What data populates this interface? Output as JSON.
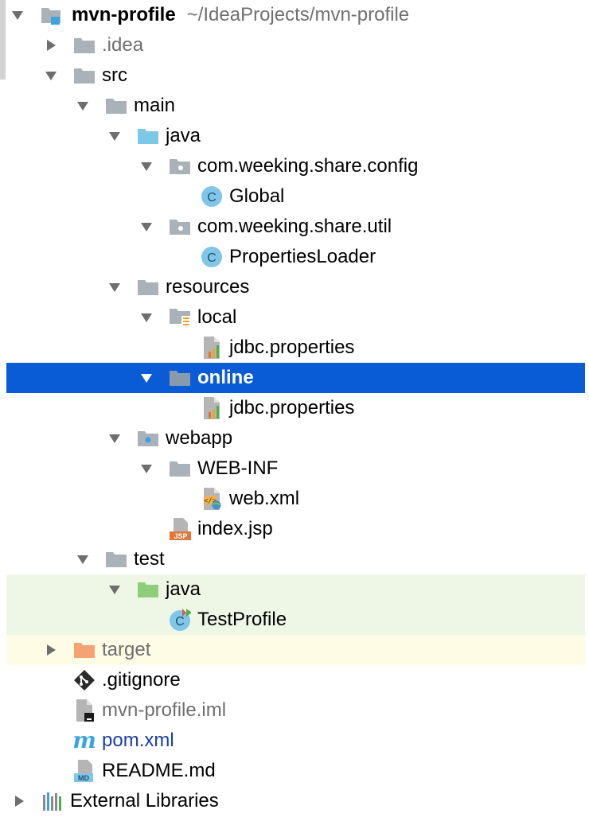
{
  "colors": {
    "selection": "#0a5cd6",
    "folder_gray": "#a9b2b8",
    "source_blue": "#7cc8e6",
    "test_green": "#8fce79",
    "excluded_orange": "#f4a470",
    "class_circle": "#7fc6e8",
    "test_row_bg": "#eef7e6",
    "excluded_row_bg": "#fefce4"
  },
  "tree": {
    "root": {
      "name": "mvn-profile",
      "path": "~/IdeaProjects/mvn-profile",
      "icon": "module-folder-icon"
    },
    "idea": {
      "label": ".idea",
      "icon": "folder-icon"
    },
    "src": {
      "label": "src",
      "icon": "folder-icon"
    },
    "main": {
      "label": "main",
      "icon": "folder-icon"
    },
    "main_java": {
      "label": "java",
      "icon": "source-root-folder-icon"
    },
    "pkg_config": {
      "label": "com.weeking.share.config",
      "icon": "package-icon"
    },
    "class_global": {
      "label": "Global",
      "icon": "java-class-icon"
    },
    "pkg_util": {
      "label": "com.weeking.share.util",
      "icon": "package-icon"
    },
    "class_loader": {
      "label": "PropertiesLoader",
      "icon": "java-class-icon"
    },
    "resources": {
      "label": "resources",
      "icon": "folder-icon"
    },
    "local": {
      "label": "local",
      "icon": "resource-folder-icon"
    },
    "local_jdbc": {
      "label": "jdbc.properties",
      "icon": "properties-file-icon"
    },
    "online": {
      "label": "online",
      "icon": "folder-icon"
    },
    "online_jdbc": {
      "label": "jdbc.properties",
      "icon": "properties-file-icon"
    },
    "webapp": {
      "label": "webapp",
      "icon": "web-folder-icon"
    },
    "webinf": {
      "label": "WEB-INF",
      "icon": "folder-icon"
    },
    "webxml": {
      "label": "web.xml",
      "icon": "web-xml-icon"
    },
    "indexjsp": {
      "label": "index.jsp",
      "icon": "jsp-file-icon",
      "badge": "JSP"
    },
    "test": {
      "label": "test",
      "icon": "folder-icon"
    },
    "test_java": {
      "label": "java",
      "icon": "test-root-folder-icon"
    },
    "test_profile": {
      "label": "TestProfile",
      "icon": "test-class-icon"
    },
    "target": {
      "label": "target",
      "icon": "excluded-folder-icon"
    },
    "gitignore": {
      "label": ".gitignore",
      "icon": "git-icon"
    },
    "iml": {
      "label": "mvn-profile.iml",
      "icon": "iml-file-icon"
    },
    "pom": {
      "label": "pom.xml",
      "icon": "maven-icon",
      "glyph": "m"
    },
    "readme": {
      "label": "README.md",
      "icon": "markdown-icon",
      "badge": "MD"
    },
    "external": {
      "label": "External Libraries",
      "icon": "libraries-icon"
    }
  }
}
